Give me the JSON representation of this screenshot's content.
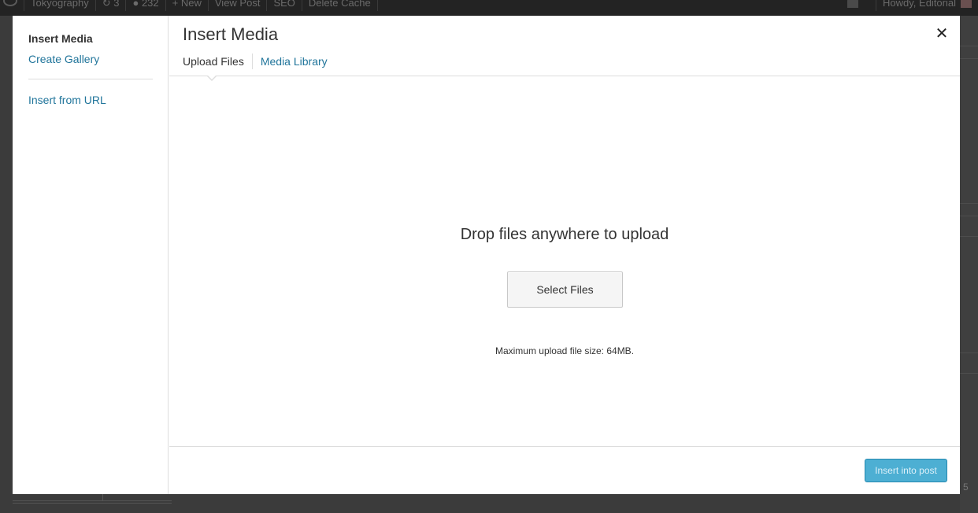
{
  "adminbar": {
    "site_name": "Tokyography",
    "updates_count": "3",
    "comments_count": "232",
    "new_label": "New",
    "view_post_label": "View Post",
    "seo_label": "SEO",
    "delete_cache_label": "Delete Cache",
    "howdy_label": "Howdy, Editorial"
  },
  "menu": {
    "items": [
      {
        "label": "Insert Media",
        "active": true
      },
      {
        "label": "Create Gallery",
        "active": false
      },
      {
        "label": "Insert from URL",
        "active": false
      }
    ]
  },
  "frame": {
    "title": "Insert Media",
    "close_glyph": "✕",
    "tabs": [
      {
        "label": "Upload Files",
        "active": true
      },
      {
        "label": "Media Library",
        "active": false
      }
    ]
  },
  "uploader": {
    "drop_text": "Drop files anywhere to upload",
    "select_button": "Select Files",
    "max_size_text": "Maximum upload file size: 64MB."
  },
  "toolbar": {
    "insert_button": "Insert into post"
  },
  "background": {
    "page_number_fragment": "5"
  },
  "colors": {
    "link": "#21759b",
    "primary_button": "#2ea2cc",
    "adminbar": "#232323",
    "overlay": "#3b3b3b"
  }
}
